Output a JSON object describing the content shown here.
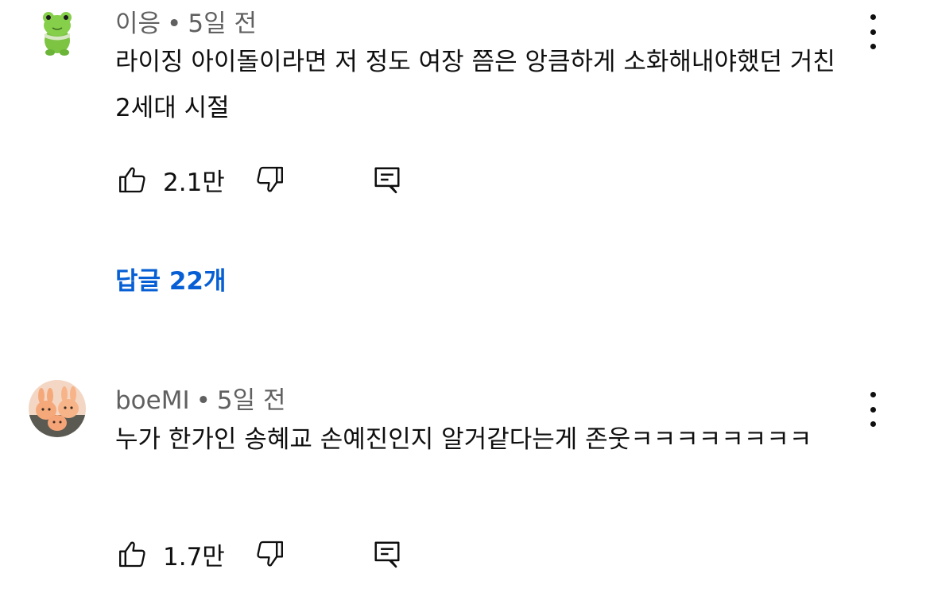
{
  "comments": [
    {
      "author": "이응",
      "separator": "•",
      "time": "5일 전",
      "text": "라이징 아이돌이라면 저 정도 여장 쯤은 앙큼하게 소화해내야했던 거친 2세대 시절",
      "likes": "2.1만",
      "avatar_icon": "frog-plush-avatar",
      "replies_label": "답글 22개"
    },
    {
      "author": "boeMI",
      "separator": "•",
      "time": "5일 전",
      "text": "누가 한가인 송혜교 손예진인지 알거같다는게 존웃ㅋㅋㅋㅋㅋㅋㅋㅋ",
      "likes": "1.7만",
      "avatar_icon": "rabbit-plush-avatar"
    }
  ],
  "colors": {
    "meta": "#606060",
    "text": "#0f0f0f",
    "link": "#065fd4"
  }
}
